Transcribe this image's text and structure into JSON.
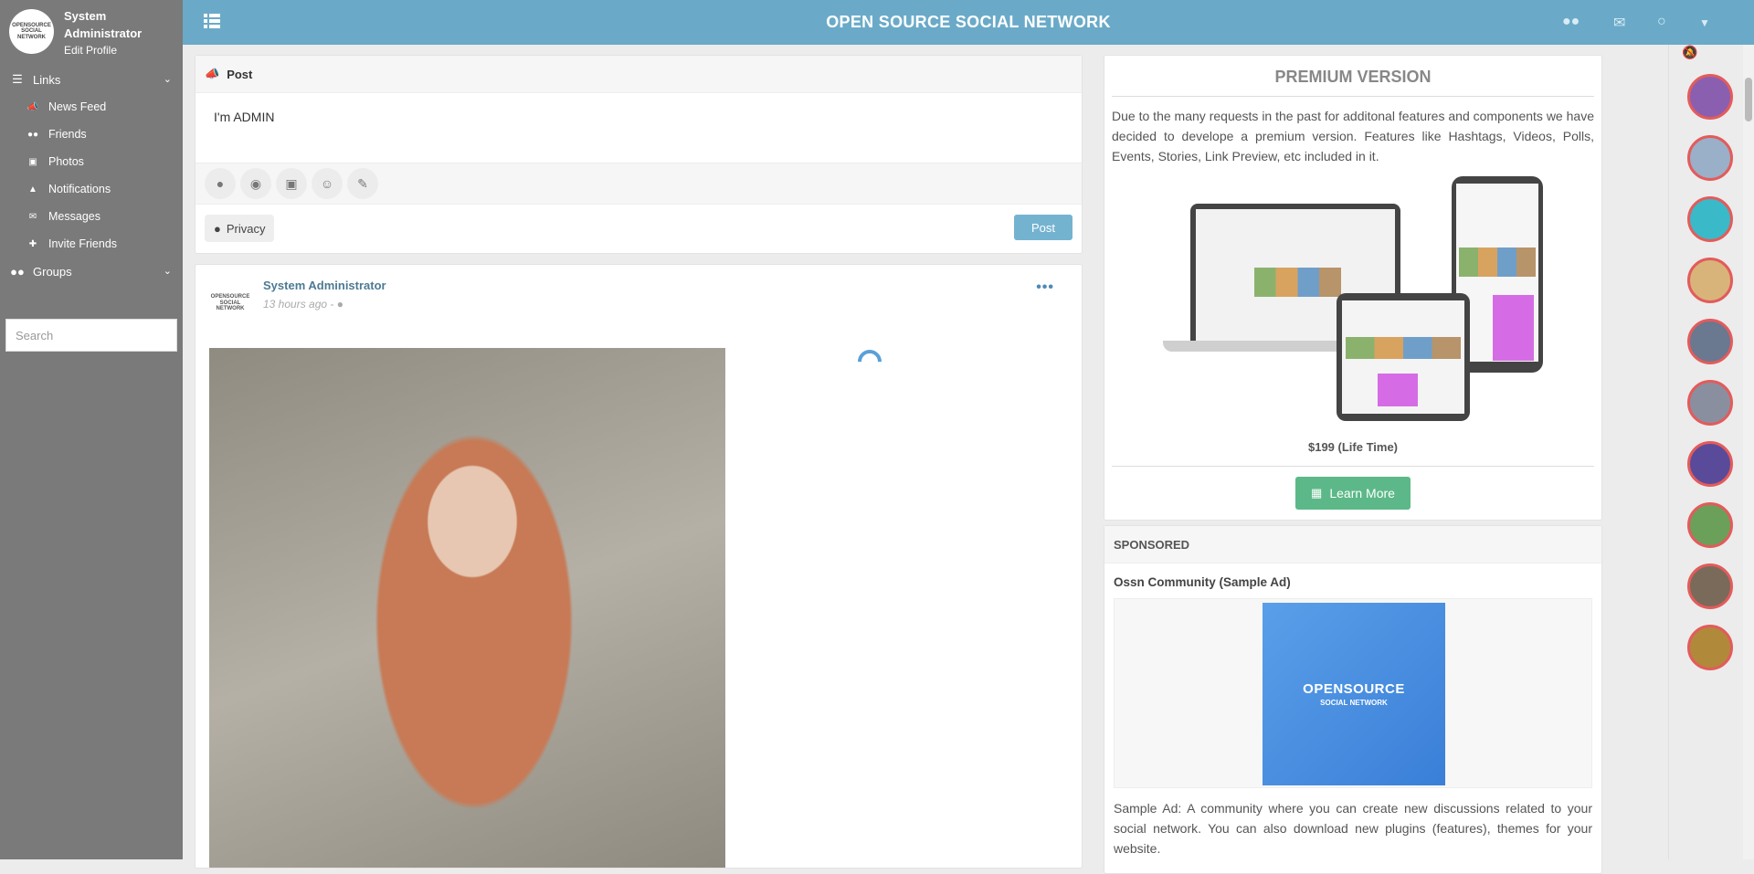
{
  "app": {
    "title": "OPEN SOURCE SOCIAL NETWORK",
    "brand_color": "#6aaac8"
  },
  "profile": {
    "name": "System Administrator",
    "edit_label": "Edit Profile",
    "avatar_text": "OPENSOURCE SOCIAL NETWORK"
  },
  "sidebar": {
    "links_label": "Links",
    "items": [
      {
        "label": "News Feed",
        "icon": "bullhorn-icon"
      },
      {
        "label": "Friends",
        "icon": "users-icon"
      },
      {
        "label": "Photos",
        "icon": "image-icon"
      },
      {
        "label": "Notifications",
        "icon": "bell-icon"
      },
      {
        "label": "Messages",
        "icon": "envelope-icon"
      },
      {
        "label": "Invite Friends",
        "icon": "user-plus-icon"
      }
    ],
    "groups_label": "Groups",
    "search_placeholder": "Search"
  },
  "composer": {
    "header": "Post",
    "text": "I'm ADMIN",
    "privacy_label": "Privacy",
    "post_button": "Post",
    "tools": [
      "users-icon",
      "location-icon",
      "image-icon",
      "smile-icon",
      "brush-icon"
    ]
  },
  "post": {
    "author": "System Administrator",
    "time": "13 hours ago - ",
    "avatar_text": "OPENSOURCE SOCIAL NETWORK"
  },
  "premium": {
    "title": "PREMIUM VERSION",
    "description": "Due to the many requests in the past for additonal features and components we have decided to develope a premium version. Features like Hashtags, Videos, Polls, Events, Stories, Link Preview, etc included in it.",
    "price": "$199 (Life Time)",
    "learn_more": "Learn More"
  },
  "sponsored": {
    "header": "SPONSORED",
    "ad_title": "Ossn Community (Sample Ad)",
    "ad_image_line1": "OPENSOURCE",
    "ad_image_line2": "SOCIAL NETWORK",
    "ad_text": "Sample Ad: A community where you can create new discussions related to your social network. You can also download new plugins (features), themes for your website."
  }
}
